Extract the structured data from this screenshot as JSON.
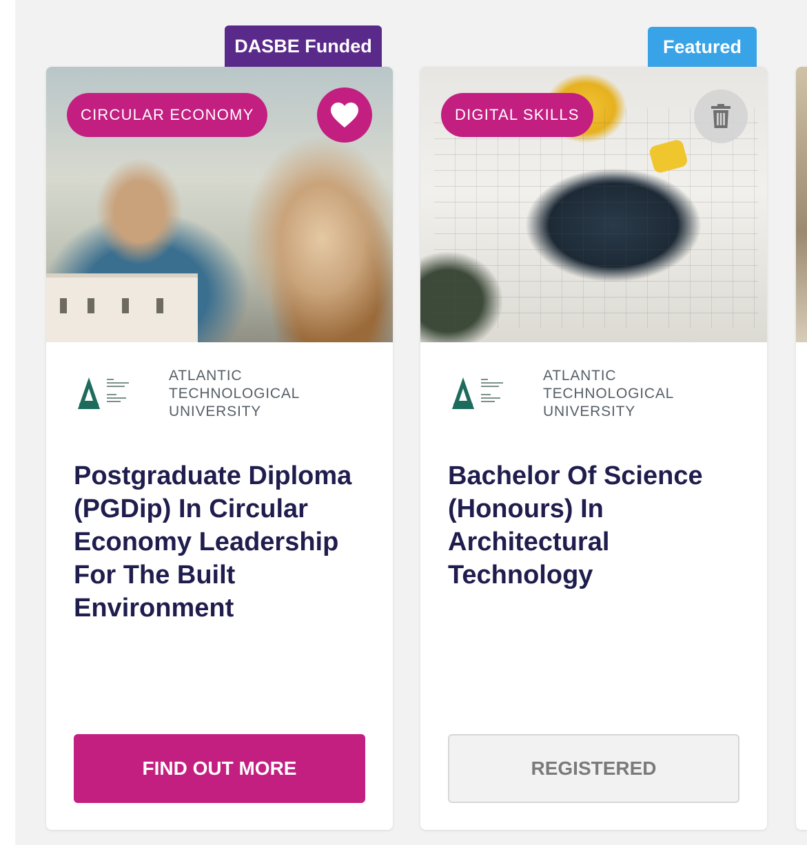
{
  "cards": [
    {
      "ribbon": "DASBE Funded",
      "category_tag": "CIRCULAR ECONOMY",
      "action_icon": "heart-icon",
      "provider": "ATLANTIC\nTECHNOLOGICAL\nUNIVERSITY",
      "title": "Postgraduate Diploma (PGDip) In Circular Economy Leadership For The Built Environment",
      "cta_label": "FIND OUT MORE"
    },
    {
      "ribbon": "Featured",
      "category_tag": "DIGITAL SKILLS",
      "action_icon": "trash-icon",
      "provider": "ATLANTIC\nTECHNOLOGICAL\nUNIVERSITY",
      "title": "Bachelor Of Science (Honours) In Architectural Technology",
      "cta_label": "REGISTERED"
    }
  ],
  "colors": {
    "brand_magenta": "#c31f81",
    "ribbon_purple": "#5a2a8a",
    "ribbon_blue": "#38a3e6",
    "title_navy": "#1f1d4d",
    "logo_teal": "#1c6b5d"
  }
}
